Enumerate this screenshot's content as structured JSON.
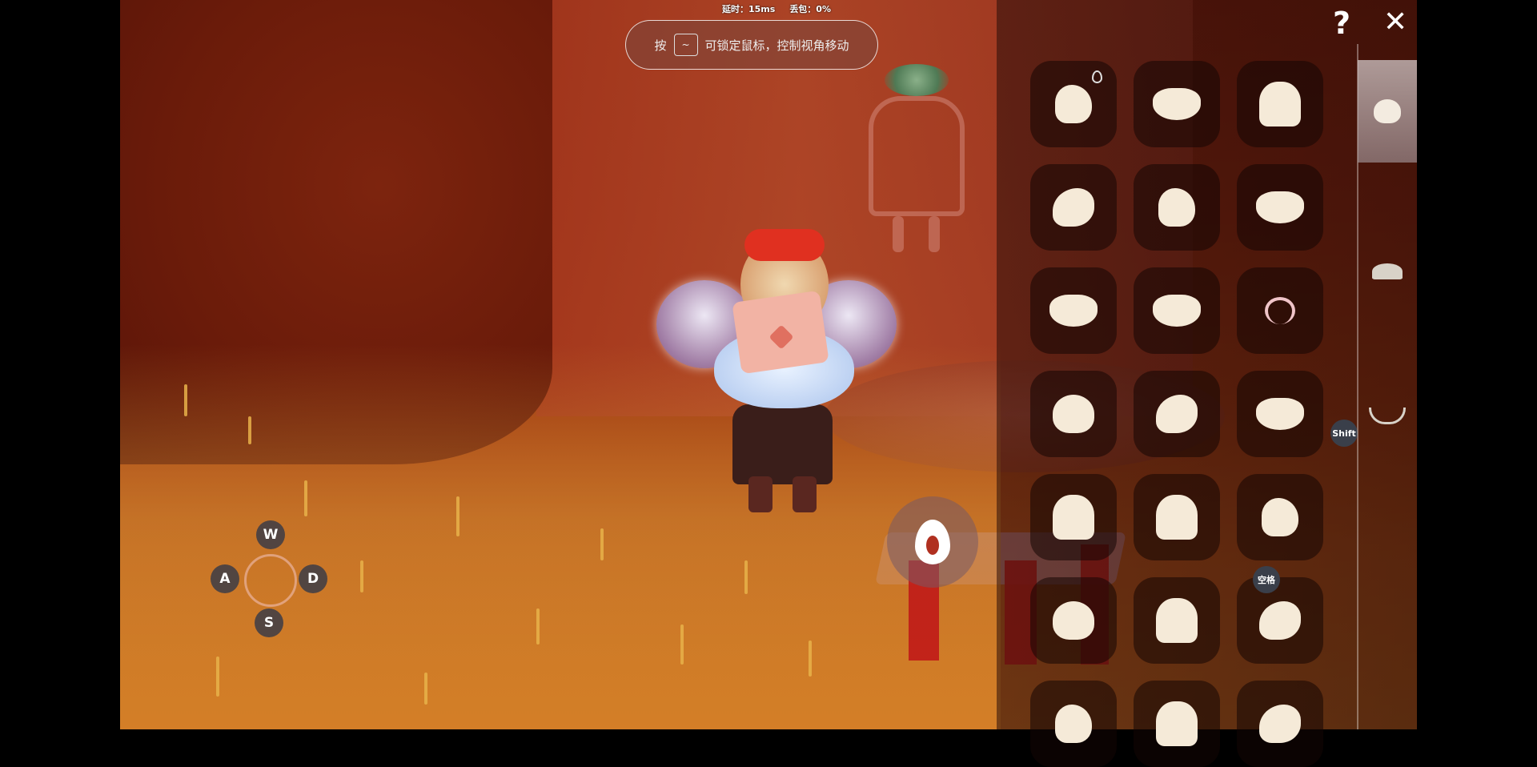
{
  "hud": {
    "latency_label": "延时：15ms",
    "packet_loss_label": "丢包：0%"
  },
  "hint": {
    "prefix": "按",
    "key": "~",
    "text": "可锁定鼠标，控制视角移动"
  },
  "movement_keys": {
    "up": "W",
    "left": "A",
    "right": "D",
    "down": "S"
  },
  "panel": {
    "help_label": "?",
    "close_label": "✕",
    "shift_badge": "Shift",
    "space_badge": "空格",
    "hairstyles": [
      "hair-icon",
      "hair-icon",
      "hair-icon",
      "hair-icon",
      "hair-icon",
      "hair-icon",
      "hair-icon",
      "hair-icon",
      "headband-icon",
      "hair-icon",
      "hair-icon",
      "hair-icon",
      "hair-icon",
      "hair-icon",
      "hair-icon",
      "hair-icon",
      "hair-icon",
      "hair-icon",
      "hair-icon",
      "hair-icon",
      "hair-icon"
    ],
    "tabs": [
      {
        "icon": "hair-icon",
        "active": true
      },
      {
        "icon": "hat-icon",
        "active": false
      },
      {
        "icon": "horns-icon",
        "active": false
      }
    ]
  },
  "colors": {
    "panel_bg": "#2a0c08",
    "hair_icon": "#f5ead8",
    "badge": "#3a3f4a"
  }
}
